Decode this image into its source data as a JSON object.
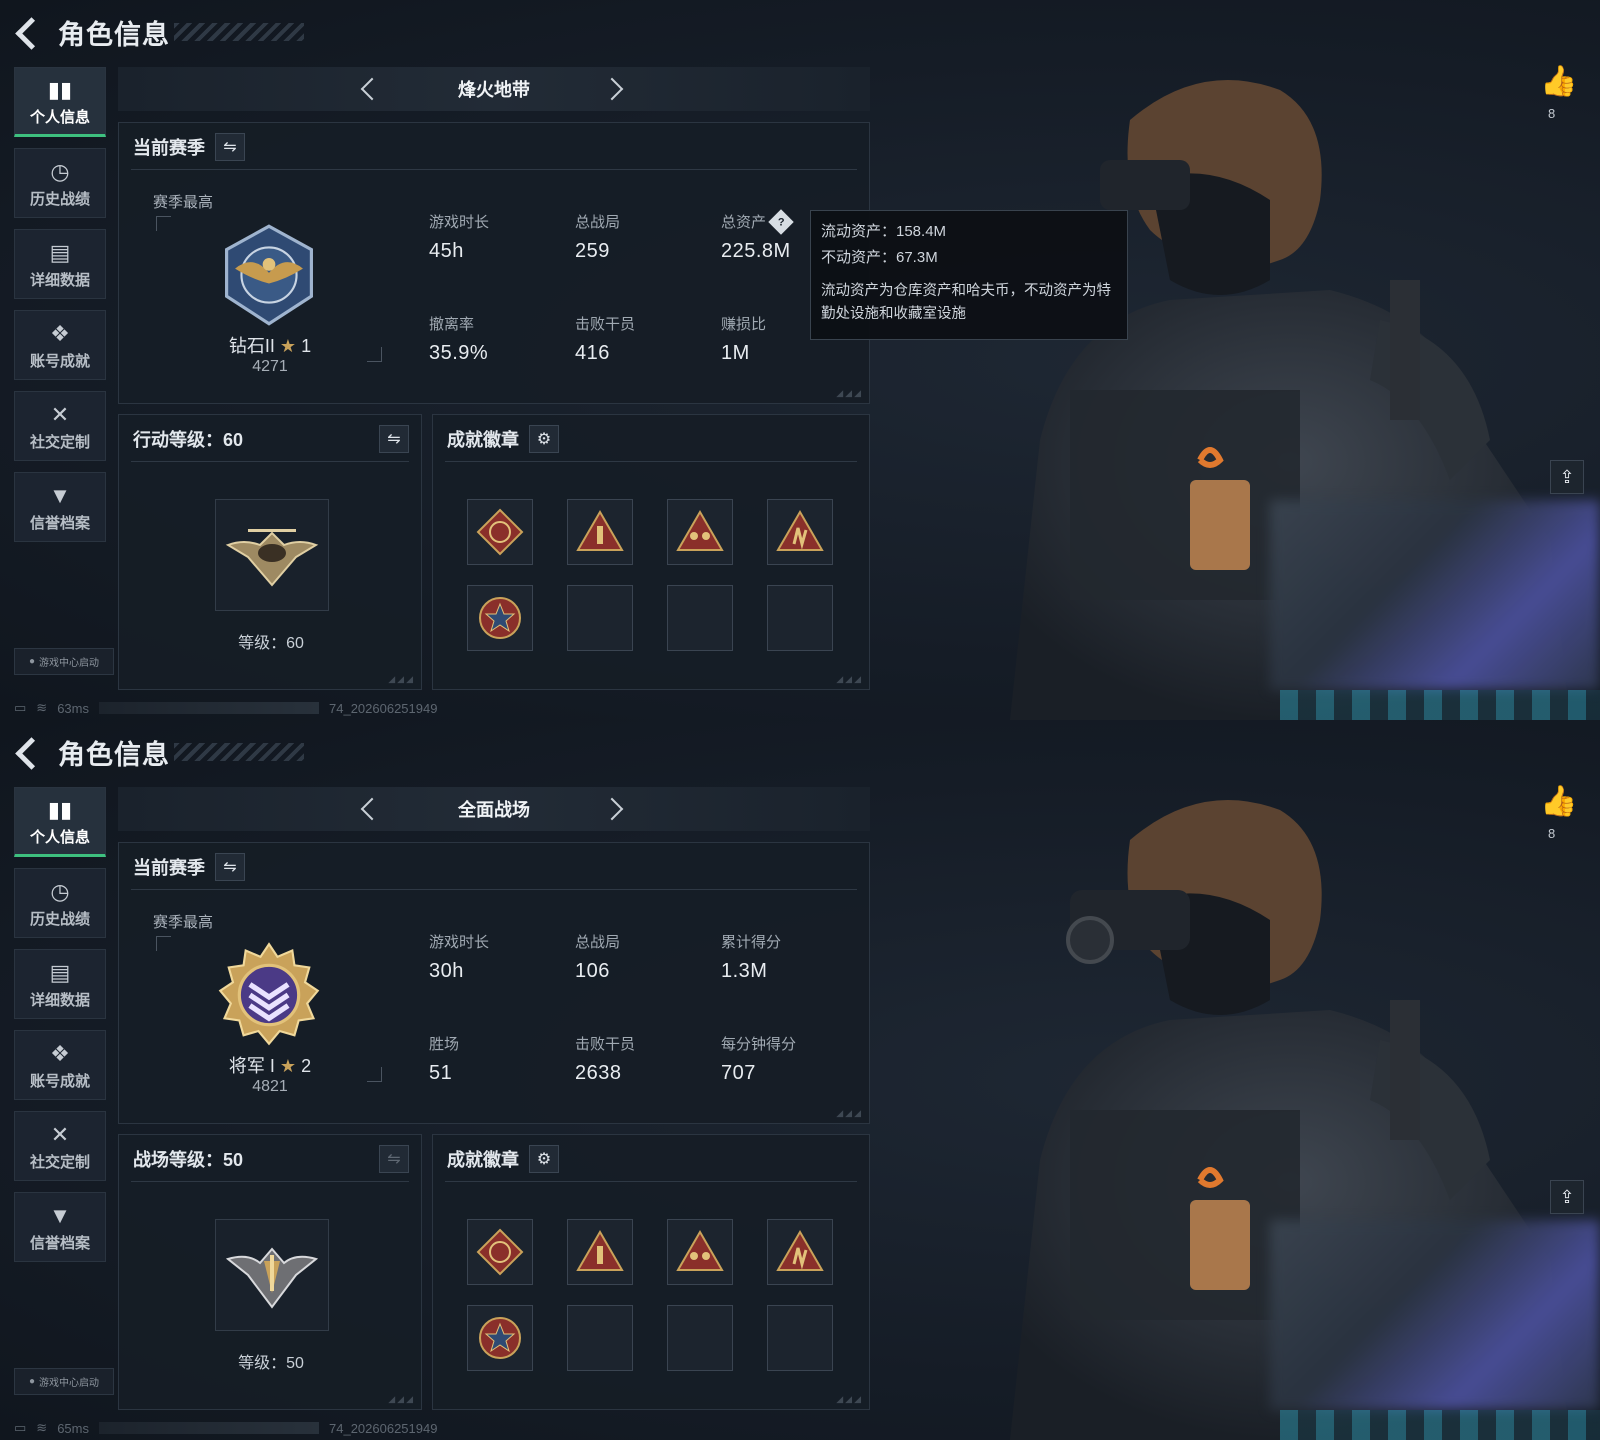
{
  "screens": [
    {
      "header": {
        "title": "角色信息"
      },
      "sidebar": {
        "items": [
          {
            "icon": "bar-chart-icon",
            "label": "个人信息",
            "active": true
          },
          {
            "icon": "clock-icon",
            "label": "历史战绩"
          },
          {
            "icon": "folder-icon",
            "label": "详细数据"
          },
          {
            "icon": "achievement-icon",
            "label": "账号成就"
          },
          {
            "icon": "tools-icon",
            "label": "社交定制"
          },
          {
            "icon": "shield-icon",
            "label": "信誉档案"
          }
        ]
      },
      "launch_badge": "游戏中心启动",
      "status": {
        "ping": "63ms",
        "build": "74_202606251949"
      },
      "mode": {
        "name": "烽火地带"
      },
      "season": {
        "title": "当前赛季",
        "best_label": "赛季最高",
        "rank_name": "钻石II",
        "rank_stars": "1",
        "rank_score": "4271",
        "stats": [
          {
            "label": "游戏时长",
            "value": "45h"
          },
          {
            "label": "总战局",
            "value": "259"
          },
          {
            "label": "总资产",
            "value": "225.8M",
            "help": true
          },
          {
            "label": "撤离率",
            "value": "35.9%"
          },
          {
            "label": "击败干员",
            "value": "416"
          },
          {
            "label": "赚损比",
            "value": "1M"
          }
        ]
      },
      "tooltip": {
        "line1": "流动资产：158.4M",
        "line2": "不动资产：67.3M",
        "note": "流动资产为仓库资产和哈夫币，不动资产为特勤处设施和收藏室设施"
      },
      "level": {
        "title": "行动等级：60",
        "text": "等级：60"
      },
      "badges": {
        "title": "成就徽章"
      },
      "likes": {
        "count": "8"
      }
    },
    {
      "header": {
        "title": "角色信息"
      },
      "sidebar": {
        "items": [
          {
            "icon": "bar-chart-icon",
            "label": "个人信息",
            "active": true
          },
          {
            "icon": "clock-icon",
            "label": "历史战绩"
          },
          {
            "icon": "folder-icon",
            "label": "详细数据"
          },
          {
            "icon": "achievement-icon",
            "label": "账号成就"
          },
          {
            "icon": "tools-icon",
            "label": "社交定制"
          },
          {
            "icon": "shield-icon",
            "label": "信誉档案"
          }
        ]
      },
      "launch_badge": "游戏中心启动",
      "status": {
        "ping": "65ms",
        "build": "74_202606251949"
      },
      "mode": {
        "name": "全面战场"
      },
      "season": {
        "title": "当前赛季",
        "best_label": "赛季最高",
        "rank_name": "将军 I",
        "rank_stars": "2",
        "rank_score": "4821",
        "stats": [
          {
            "label": "游戏时长",
            "value": "30h"
          },
          {
            "label": "总战局",
            "value": "106"
          },
          {
            "label": "累计得分",
            "value": "1.3M"
          },
          {
            "label": "胜场",
            "value": "51"
          },
          {
            "label": "击败干员",
            "value": "2638"
          },
          {
            "label": "每分钟得分",
            "value": "707"
          }
        ]
      },
      "level": {
        "title": "战场等级：50",
        "text": "等级：50"
      },
      "badges": {
        "title": "成就徽章"
      },
      "likes": {
        "count": "8"
      }
    }
  ],
  "colors": {
    "accent_green": "#3ec07f",
    "panel_bg": "#161d26",
    "badge_gold": "#c9a25a",
    "badge_red": "#8a2f2a"
  }
}
